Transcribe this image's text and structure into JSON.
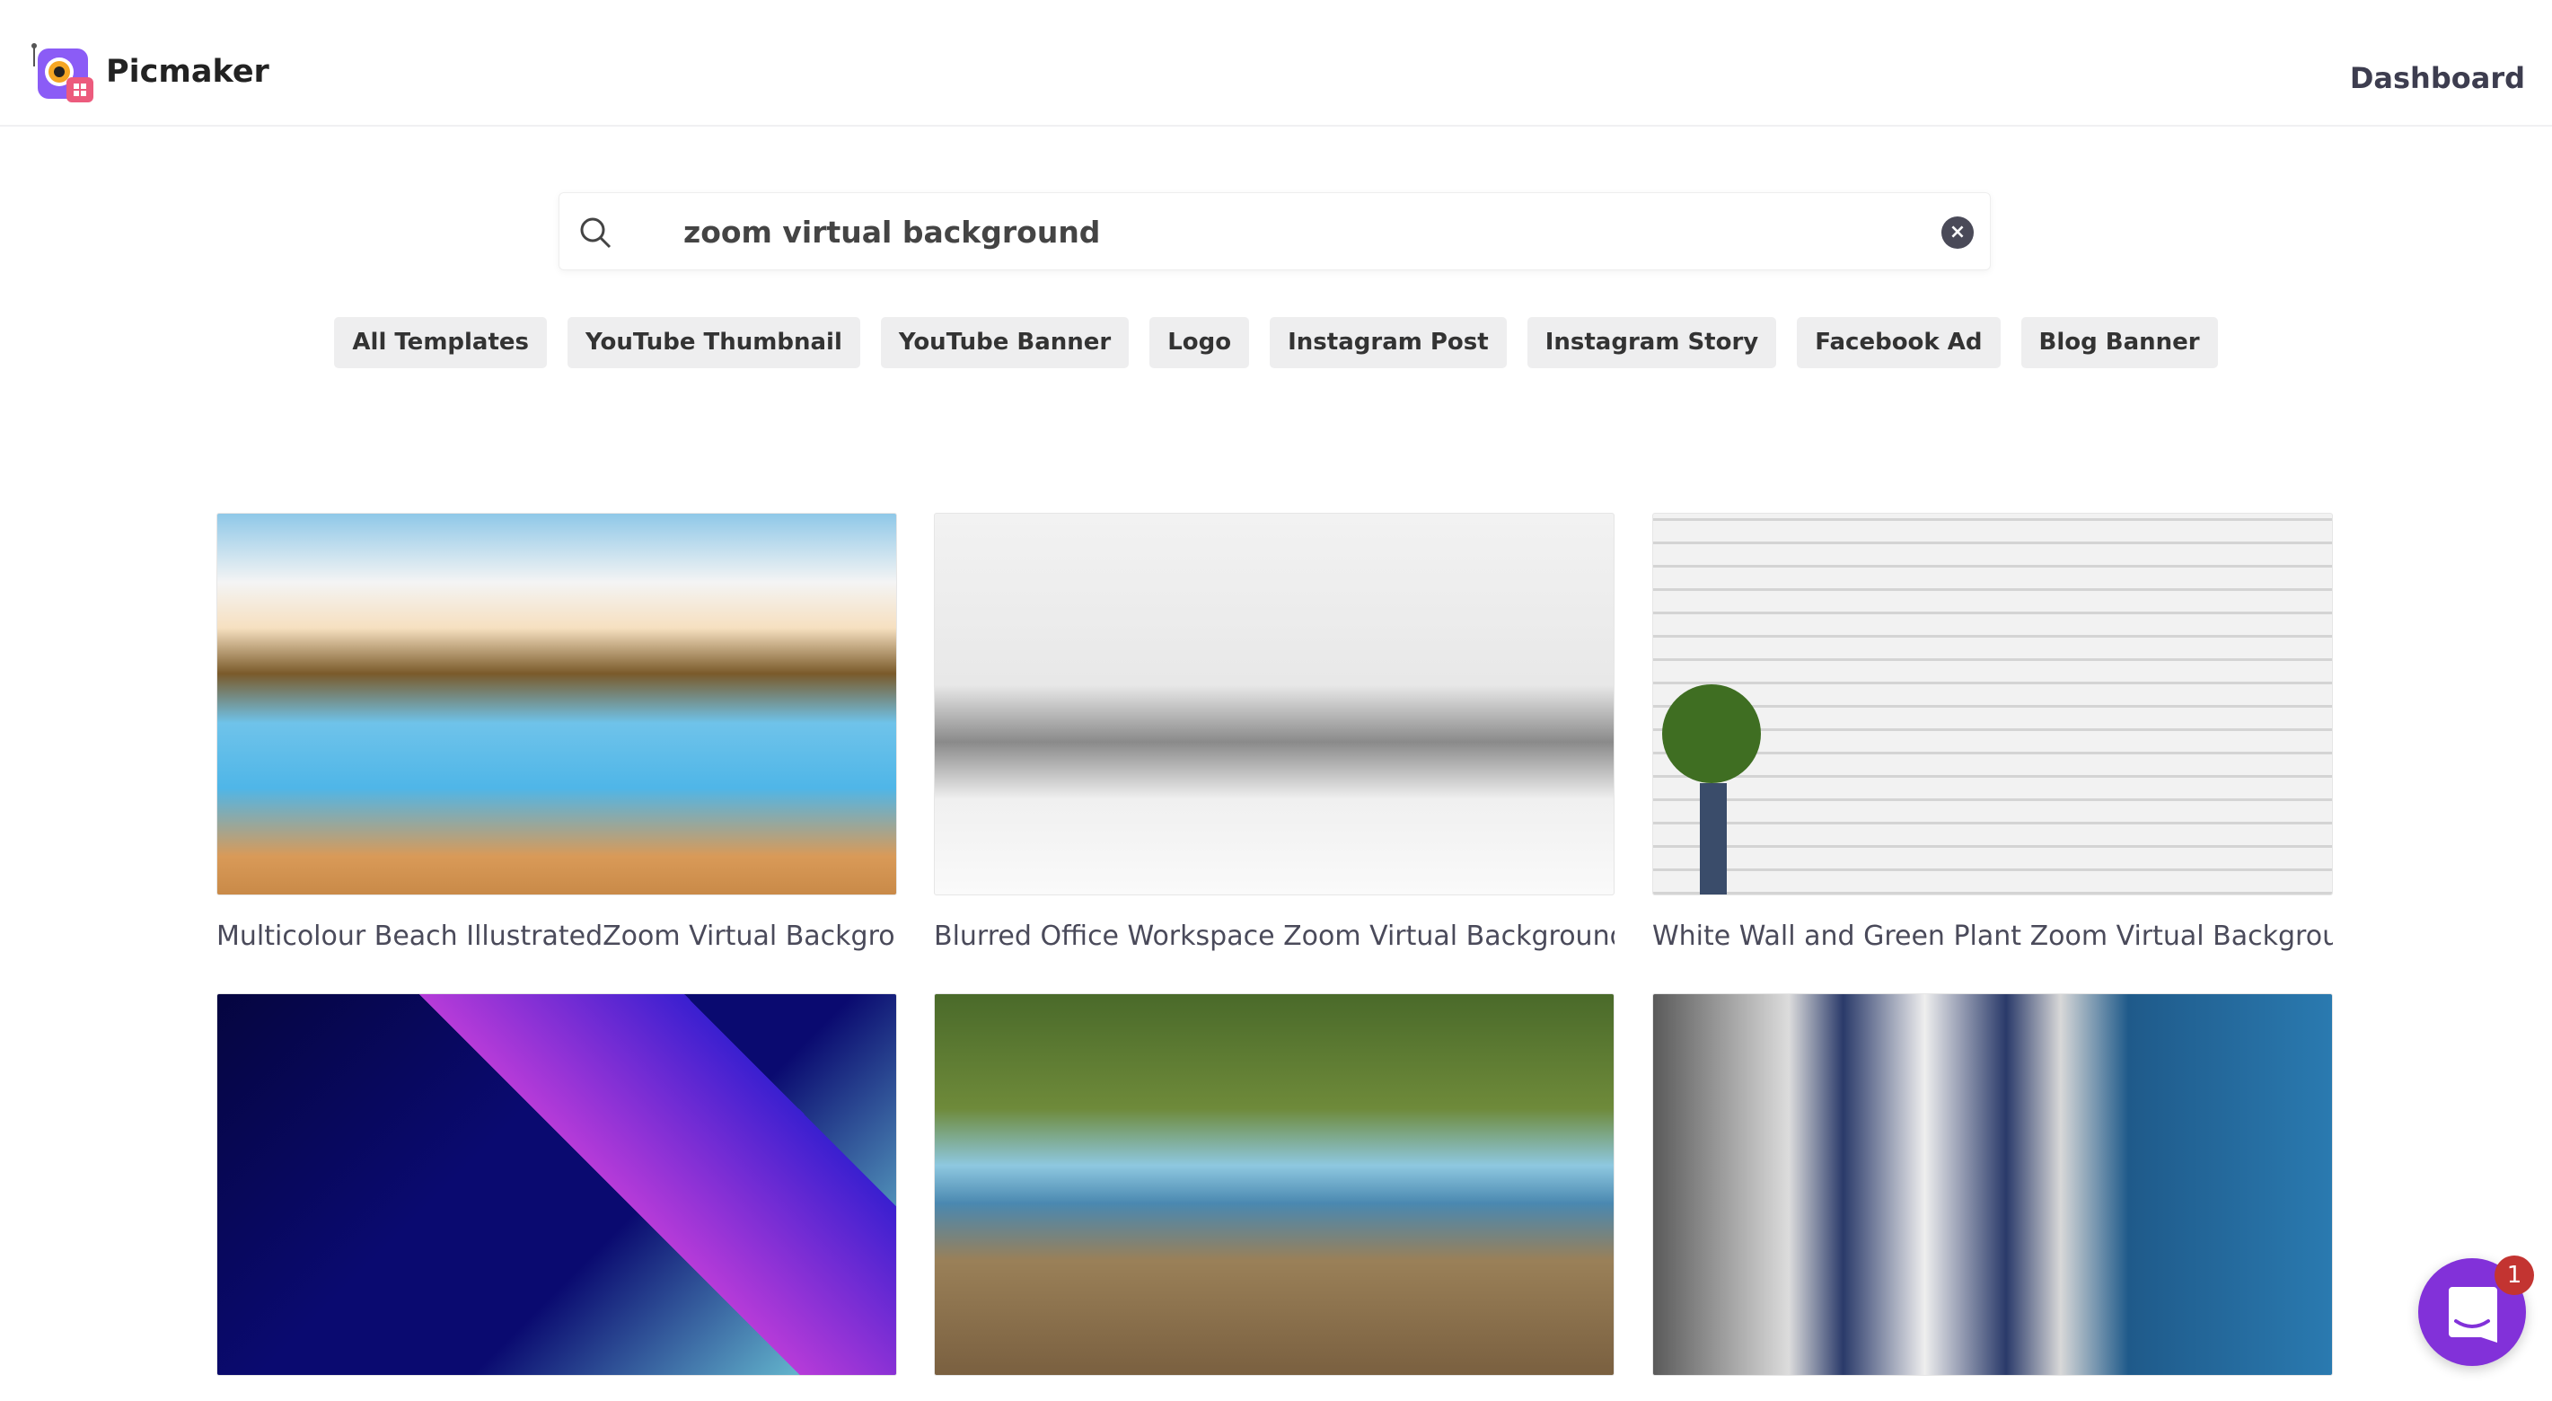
{
  "header": {
    "brand": "Picmaker",
    "dashboard_label": "Dashboard"
  },
  "search": {
    "value": "zoom virtual background",
    "icon": "search-icon",
    "clear_icon": "close-circle-icon"
  },
  "chips": [
    "All Templates",
    "YouTube Thumbnail",
    "YouTube Banner",
    "Logo",
    "Instagram Post",
    "Instagram Story",
    "Facebook Ad",
    "Blog Banner"
  ],
  "templates": [
    {
      "title": "Multicolour Beach IllustratedZoom Virtual Backgroun..."
    },
    {
      "title": "Blurred Office Workspace Zoom Virtual Background Te..."
    },
    {
      "title": "White Wall and Green Plant Zoom Virtual Background ..."
    },
    {
      "title": ""
    },
    {
      "title": ""
    },
    {
      "title": ""
    }
  ],
  "chat": {
    "badge": "1",
    "accent": "#8231d9"
  }
}
